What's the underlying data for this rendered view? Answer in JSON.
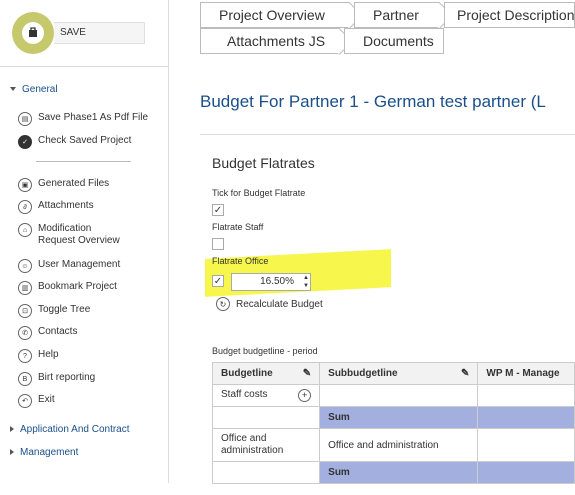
{
  "sidebar": {
    "save_label": "SAVE",
    "general_label": "General",
    "items": [
      {
        "label": "Save Phase1 As Pdf File",
        "icon": "print-icon"
      },
      {
        "label": "Check Saved Project",
        "icon": "check-circle-icon"
      },
      {
        "label": "Generated Files",
        "icon": "file-icon"
      },
      {
        "label": "Attachments",
        "icon": "paperclip-icon"
      },
      {
        "label": "Modification Request Overview",
        "icon": "bank-icon"
      },
      {
        "label": "User Management",
        "icon": "user-icon"
      },
      {
        "label": "Bookmark Project",
        "icon": "book-icon"
      },
      {
        "label": "Toggle Tree",
        "icon": "tree-icon"
      },
      {
        "label": "Contacts",
        "icon": "phone-icon"
      },
      {
        "label": "Help",
        "icon": "help-icon"
      },
      {
        "label": "Birt reporting",
        "icon": "report-icon"
      },
      {
        "label": "Exit",
        "icon": "exit-icon"
      }
    ],
    "application_label": "Application And Contract",
    "management_label": "Management"
  },
  "tabs": {
    "row1": [
      "Project Overview",
      "Partner",
      "Project Description"
    ],
    "row2": [
      "Attachments JS",
      "Documents"
    ]
  },
  "page": {
    "title": "Budget For Partner 1 - German test partner (L",
    "section_title": "Budget Flatrates",
    "tick_label": "Tick for Budget Flatrate",
    "staff_label": "Flatrate Staff",
    "office_label": "Flatrate Office",
    "office_value": "16.50%",
    "recalc_label": "Recalculate Budget",
    "table_caption": "Budget budgetline - period"
  },
  "table": {
    "headers": [
      "Budgetline",
      "Subbudgetline",
      "WP M - Manage"
    ],
    "rows": [
      {
        "budgetline": "Staff costs",
        "sub": "",
        "wp": ""
      },
      {
        "budgetline": "",
        "sub": "Sum",
        "wp": ""
      },
      {
        "budgetline": "Office and administration",
        "sub": "Office and administration",
        "wp": ""
      },
      {
        "budgetline": "",
        "sub": "Sum",
        "wp": ""
      }
    ]
  },
  "colors": {
    "accent": "#1b4f8a",
    "logo": "#c5c96b",
    "sum": "#a3afdf",
    "highlight": "#f5f542"
  }
}
